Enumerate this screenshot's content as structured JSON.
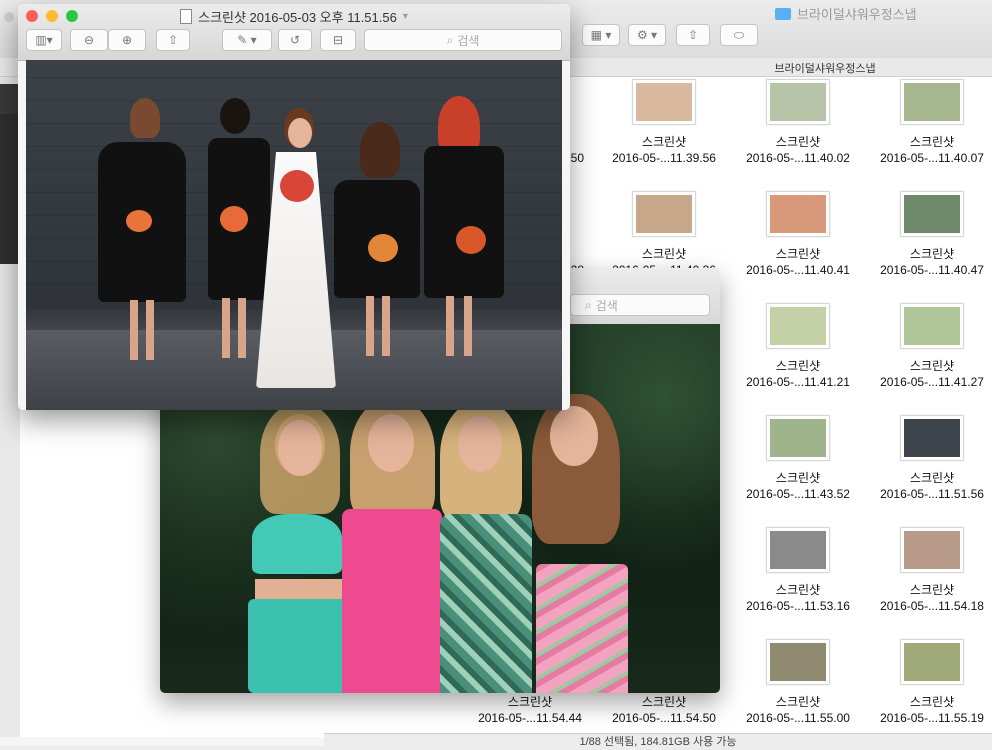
{
  "finder": {
    "title": "브라이덜샤워우정스냅",
    "path_label": "브라이덜샤워우정스냅",
    "status": "1/88 선택됨, 184.81GB 사용 가능",
    "partial_captions": [
      "50",
      "28"
    ],
    "grid": [
      {
        "name": "스크린샷",
        "date": "2016-05-...11.39.56",
        "thumb": "#d8b9a0"
      },
      {
        "name": "스크린샷",
        "date": "2016-05-...11.40.02",
        "thumb": "#b8c4a8"
      },
      {
        "name": "스크린샷",
        "date": "2016-05-...11.40.07",
        "thumb": "#a7b890"
      },
      {
        "name": "스크린샷",
        "date": "2016-05-...11.40.36",
        "thumb": "#c7a88a"
      },
      {
        "name": "스크린샷",
        "date": "2016-05-...11.40.41",
        "thumb": "#d89a7a"
      },
      {
        "name": "스크린샷",
        "date": "2016-05-...11.40.47",
        "thumb": "#6f8a6a"
      },
      {
        "name": "스크린샷",
        "date": "2016-05-...11.41.21",
        "thumb": "#c4d0a6"
      },
      {
        "name": "스크린샷",
        "date": "2016-05-...11.41.27",
        "thumb": "#b0c698"
      },
      {
        "name": "스크린샷",
        "date": "2016-05-...11.43.52",
        "thumb": "#9fb48a"
      },
      {
        "name": "스크린샷",
        "date": "2016-05-...11.51.56",
        "thumb": "#3e444c"
      },
      {
        "name": "스크린샷",
        "date": "2016-05-...11.53.16",
        "thumb": "#8a8a8a"
      },
      {
        "name": "스크린샷",
        "date": "2016-05-...11.54.18",
        "thumb": "#b89a88"
      },
      {
        "name": "스크린샷",
        "date": "2016-05-...11.54.44",
        "thumb": "#2e4a33"
      },
      {
        "name": "스크린샷",
        "date": "2016-05-...11.54.50",
        "thumb": "#2a4030"
      },
      {
        "name": "스크린샷",
        "date": "2016-05-...11.55.00",
        "thumb": "#8f8a70"
      },
      {
        "name": "스크린샷",
        "date": "2016-05-...11.55.19",
        "thumb": "#a0aa78"
      }
    ]
  },
  "preview_main": {
    "title": "스크린샷 2016-05-03 오후 11.51.56",
    "search_placeholder": "검색",
    "colors": {
      "close": "#fc5f57",
      "minimize": "#fdbc2e",
      "zoom": "#28c840"
    }
  },
  "preview_second": {
    "search_placeholder": "검색"
  }
}
